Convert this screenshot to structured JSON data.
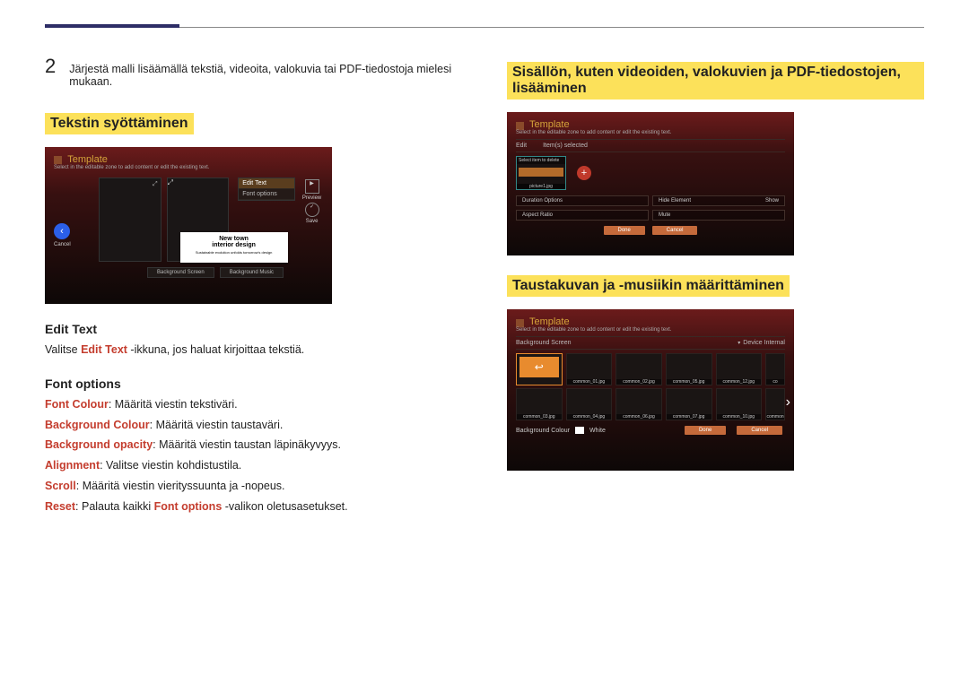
{
  "step_number": "2",
  "step_text": "Järjestä malli lisäämällä tekstiä, videoita, valokuvia tai PDF-tiedostoja mielesi mukaan.",
  "h_text_input": "Tekstin syöttäminen",
  "h_add_content": "Sisällön, kuten videoiden, valokuvien ja PDF-tiedostojen, lisääminen",
  "h_set_bg": "Taustakuvan ja -musiikin määrittäminen",
  "edit_text_heading": "Edit Text",
  "edit_text_sentence_prefix": "Valitse ",
  "edit_text_label": "Edit Text",
  "edit_text_sentence_suffix": " -ikkuna, jos haluat kirjoittaa tekstiä.",
  "font_options_heading": "Font options",
  "opt_font_colour_label": "Font Colour",
  "opt_font_colour_desc": ": Määritä viestin tekstiväri.",
  "opt_bg_colour_label": "Background Colour",
  "opt_bg_colour_desc": ": Määritä viestin taustaväri.",
  "opt_bg_opacity_label": "Background opacity",
  "opt_bg_opacity_desc": ": Määritä viestin taustan läpinäkyvyys.",
  "opt_align_label": "Alignment",
  "opt_align_desc": ": Valitse viestin kohdistustila.",
  "opt_scroll_label": "Scroll",
  "opt_scroll_desc": ": Määritä viestin vierityssuunta ja -nopeus.",
  "opt_reset_label": "Reset",
  "opt_reset_p1": ": Palauta kaikki ",
  "opt_reset_mid": "Font options",
  "opt_reset_p2": " -valikon oletusasetukset.",
  "fig1": {
    "template": "Template",
    "subtitle": "Select in the editable zone to add content or edit the existing text.",
    "caption_line1": "New town",
    "caption_line2": "interior design",
    "caption_line3": "Sustainable evolution unfolds tomorrow's design",
    "ctx_edit": "Edit Text",
    "ctx_font": "Font options",
    "preview": "Preview",
    "save": "Save",
    "cancel": "Cancel",
    "btn_bg_screen": "Background Screen",
    "btn_bg_music": "Background Music"
  },
  "fig2": {
    "template": "Template",
    "subtitle": "Select in the editable zone to add content or edit the existing text.",
    "edit": "Edit",
    "items_selected": "Item(s) selected",
    "select_to_delete": "Select item to delete",
    "tile_label": "picture1.jpg",
    "duration": "Duration Options",
    "aspect": "Aspect Ratio",
    "hide": "Hide Element",
    "show": "Show",
    "mute": "Mute",
    "done": "Done",
    "cancel": "Cancel"
  },
  "fig3": {
    "template": "Template",
    "subtitle": "Select in the editable zone to add content or edit the existing text.",
    "bg_screen": "Background Screen",
    "device": "Device Internal",
    "thumbs_row1": [
      "",
      "common_01.jpg",
      "common_02.jpg",
      "common_05.jpg",
      "common_12.jpg",
      "co"
    ],
    "thumbs_row2": [
      "common_03.jpg",
      "common_04.jpg",
      "common_06.jpg",
      "common_07.jpg",
      "common_10.jpg",
      "common"
    ],
    "bg_colour": "Background Colour",
    "white": "White",
    "done": "Done",
    "cancel": "Cancel"
  }
}
